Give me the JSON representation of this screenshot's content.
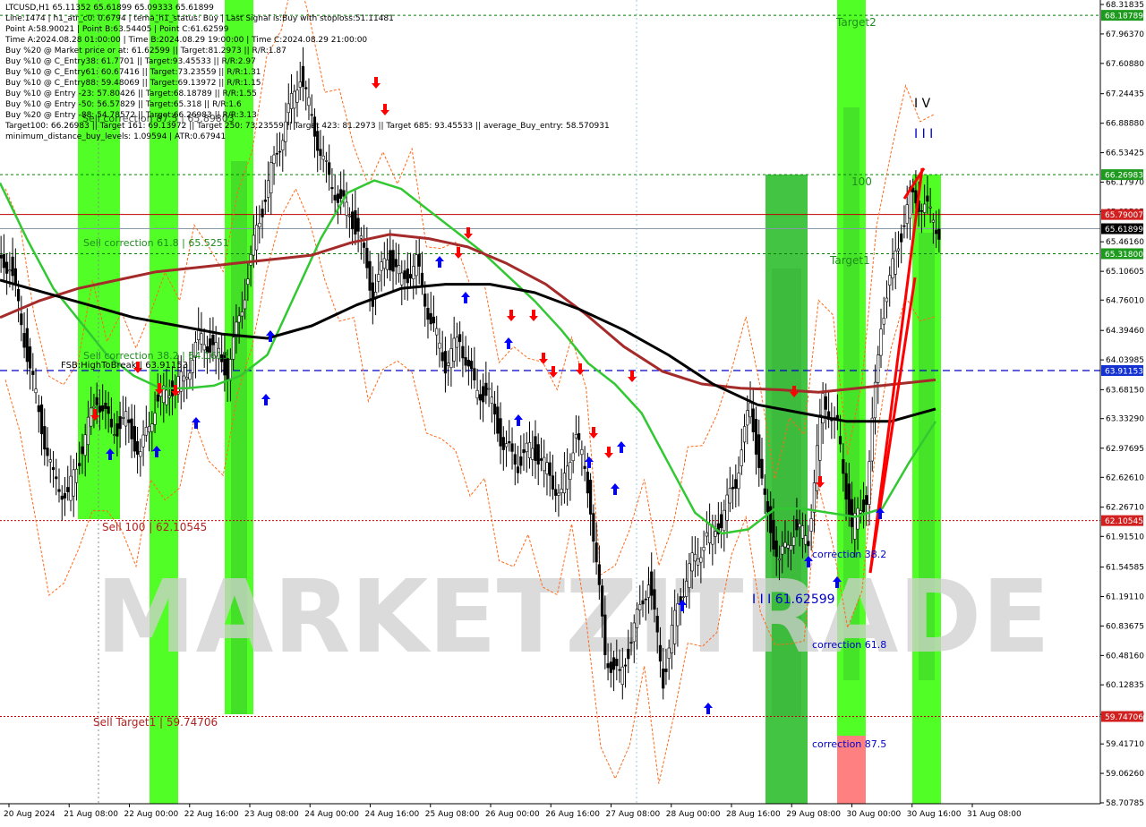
{
  "header": {
    "lines": [
      "LTCUSD,H1  65.11352 65.61899 65.09333 65.61899",
      "Line:1474 | h1_atr_c0: 0.6794 | tema_h1_status: Buy | Last Signal is:Buy with stoploss:51.11481",
      "Point A:58.90021 | Point B:63.54405 | Point C:61.62599",
      "Time A:2024.08.28 01:00:00 | Time B:2024.08.29 19:00:00 | Time C:2024.08.29 21:00:00",
      "Buy %20 @ Market price or at: 61.62599 || Target:81.2973 || R/R:1.87",
      "Buy %10 @ C_Entry38: 61.7701 || Target:93.45533 || R/R:2.97",
      "Buy %10 @ C_Entry61: 60.67416 || Target:73.23559 || R/R:1.31",
      "Buy %10 @ C_Entry88: 59.48069 || Target:69.13972 || R/R:1.15",
      "Buy %10 @ Entry -23: 57.80426 || Target:68.18789 || R/R:1.55",
      "Buy %10 @ Entry -50: 56.57829 || Target:65.318 || R/R:1.6",
      "Buy %20 @ Entry -88: 54.78572 || Target:66.26983 || R/R:3.13",
      "Target100: 66.26983 || Target 161: 69.13972 || Target 250: 73.23559 || Target 423: 81.2973 || Target 685: 93.45533 || average_Buy_entry: 58.570931",
      "minimum_distance_buy_levels: 1.09594 | ATR:0.67941"
    ],
    "overlap_text": "Sell correction 87.5 | 65.89803"
  },
  "colors": {
    "background": "#ffffff",
    "bull_candle": "#000000",
    "bear_candle": "#000000",
    "ema_green": "#32c832",
    "ema_red": "#a52a2a",
    "ema_black": "#000000",
    "zone_green": "#33ff00",
    "zone_dark_green": "#22bb22",
    "zone_salmon": "#ff8080",
    "hline_red": "#c00000",
    "hline_blue": "#0000c8",
    "hline_green": "#008000",
    "label_red_bg": "#d22020",
    "label_green_bg": "#1e9b1e",
    "label_blue_bg": "#1432d2",
    "label_black_bg": "#000000",
    "arrow_up": "#0000ff",
    "arrow_down": "#ff0000",
    "watermark": "#d0d0d0"
  },
  "price_axis": {
    "ticks": [
      "68.31835",
      "67.96370",
      "67.60880",
      "67.24435",
      "66.88880",
      "66.53425",
      "66.17970",
      "65.82505",
      "65.46160",
      "65.10605",
      "64.76010",
      "64.39460",
      "64.03985",
      "63.68150",
      "63.33290",
      "62.97695",
      "62.62610",
      "62.26710",
      "61.91510",
      "61.54585",
      "61.19110",
      "60.83675",
      "60.48160",
      "60.12835",
      "59.77180",
      "59.41710",
      "59.06260",
      "58.70785"
    ],
    "badges": [
      {
        "value": "68.18789",
        "color": "green"
      },
      {
        "value": "66.26983",
        "color": "green"
      },
      {
        "value": "65.79007",
        "color": "red"
      },
      {
        "value": "65.61899",
        "color": "black"
      },
      {
        "value": "65.31800",
        "color": "green"
      },
      {
        "value": "63.91153",
        "color": "blue"
      },
      {
        "value": "62.10545",
        "color": "red"
      },
      {
        "value": "59.74706",
        "color": "red"
      }
    ]
  },
  "time_axis": {
    "labels": [
      "20 Aug 2024",
      "21 Aug 08:00",
      "22 Aug 00:00",
      "22 Aug 16:00",
      "23 Aug 08:00",
      "24 Aug 00:00",
      "24 Aug 16:00",
      "25 Aug 08:00",
      "26 Aug 00:00",
      "26 Aug 16:00",
      "27 Aug 08:00",
      "28 Aug 00:00",
      "28 Aug 16:00",
      "29 Aug 08:00",
      "30 Aug 00:00",
      "30 Aug 16:00",
      "31 Aug 08:00"
    ]
  },
  "annotations": {
    "sell_correction_618": "Sell correction 61.8 | 65.5251",
    "sell_correction_382": "Sell correction 38.2 | 64.1615",
    "fsb": "FSB:HighToBreak | 63.91153",
    "sell_100": "Sell 100 | 62.10545",
    "sell_target1": "Sell Target1 | 59.74706",
    "target2": "Target2",
    "target1": "Target1",
    "hundred": "100",
    "wave_iv": "I V",
    "wave_iii": "I I I",
    "correction_382": "correction 38.2",
    "correction_618": "correction 61.8",
    "correction_875": "correction 87.5",
    "point_c": "I I I 61.62599",
    "watermark": "MARKETZITRADE"
  },
  "chart_data": {
    "type": "candlestick",
    "symbol": "LTCUSD",
    "timeframe": "H1",
    "ylim": [
      58.70785,
      68.31835
    ],
    "x": [
      "20 Aug 2024",
      "21 Aug 08:00",
      "22 Aug 00:00",
      "22 Aug 16:00",
      "23 Aug 08:00",
      "24 Aug 00:00",
      "24 Aug 16:00",
      "25 Aug 08:00",
      "26 Aug 00:00",
      "26 Aug 16:00",
      "27 Aug 08:00",
      "28 Aug 00:00",
      "28 Aug 16:00",
      "29 Aug 08:00",
      "30 Aug 00:00",
      "30 Aug 16:00",
      "31 Aug 08:00"
    ],
    "close_path": [
      65.2,
      64.3,
      63.4,
      62.6,
      62.4,
      63.0,
      63.6,
      63.2,
      63.3,
      62.9,
      63.5,
      63.7,
      63.8,
      64.3,
      64.2,
      63.9,
      64.7,
      65.6,
      66.3,
      66.9,
      67.5,
      66.8,
      66.2,
      65.9,
      65.6,
      64.8,
      65.3,
      65.0,
      65.2,
      64.5,
      64.0,
      64.3,
      63.7,
      63.6,
      63.0,
      62.8,
      63.0,
      62.7,
      62.4,
      63.2,
      62.3,
      60.5,
      60.2,
      60.8,
      61.4,
      60.2,
      61.1,
      61.6,
      61.9,
      62.1,
      62.6,
      63.5,
      62.3,
      61.6,
      62.0,
      61.9,
      63.6,
      63.2,
      62.0,
      62.4,
      64.5,
      65.3,
      66.0,
      65.9,
      65.6
    ],
    "series": [
      {
        "name": "EMA green",
        "values": [
          66.17,
          65.5,
          64.9,
          64.5,
          64.1,
          63.85,
          63.7,
          63.7,
          63.73,
          63.85,
          64.1,
          64.8,
          65.5,
          66.05,
          66.2,
          66.1,
          65.85,
          65.6,
          65.35,
          65.05,
          64.75,
          64.4,
          64.0,
          63.75,
          63.4,
          62.8,
          62.2,
          61.95,
          62.0,
          62.25,
          62.25,
          62.2,
          62.15,
          62.25,
          62.8,
          63.3
        ]
      },
      {
        "name": "EMA red",
        "values": [
          64.55,
          64.75,
          64.9,
          65.0,
          65.1,
          65.15,
          65.2,
          65.25,
          65.3,
          65.45,
          65.55,
          65.5,
          65.4,
          65.2,
          64.95,
          64.6,
          64.2,
          63.9,
          63.75,
          63.7,
          63.68,
          63.65,
          63.7,
          63.75,
          63.8
        ]
      },
      {
        "name": "EMA black",
        "values": [
          65.0,
          64.85,
          64.7,
          64.55,
          64.45,
          64.35,
          64.3,
          64.45,
          64.7,
          64.9,
          64.95,
          64.95,
          64.85,
          64.65,
          64.4,
          64.1,
          63.75,
          63.5,
          63.4,
          63.3,
          63.3,
          63.45
        ]
      }
    ],
    "levels": [
      {
        "label": "Target2",
        "value": 68.18789
      },
      {
        "label": "100",
        "value": 66.26983
      },
      {
        "label": "Sell correction 87.5",
        "value": 65.79007
      },
      {
        "label": "Close",
        "value": 65.61899
      },
      {
        "label": "Target1",
        "value": 65.318
      },
      {
        "label": "FSB:HighToBreak",
        "value": 63.91153
      },
      {
        "label": "Sell 100",
        "value": 62.10545
      },
      {
        "label": "Sell Target1",
        "value": 59.74706
      }
    ]
  }
}
